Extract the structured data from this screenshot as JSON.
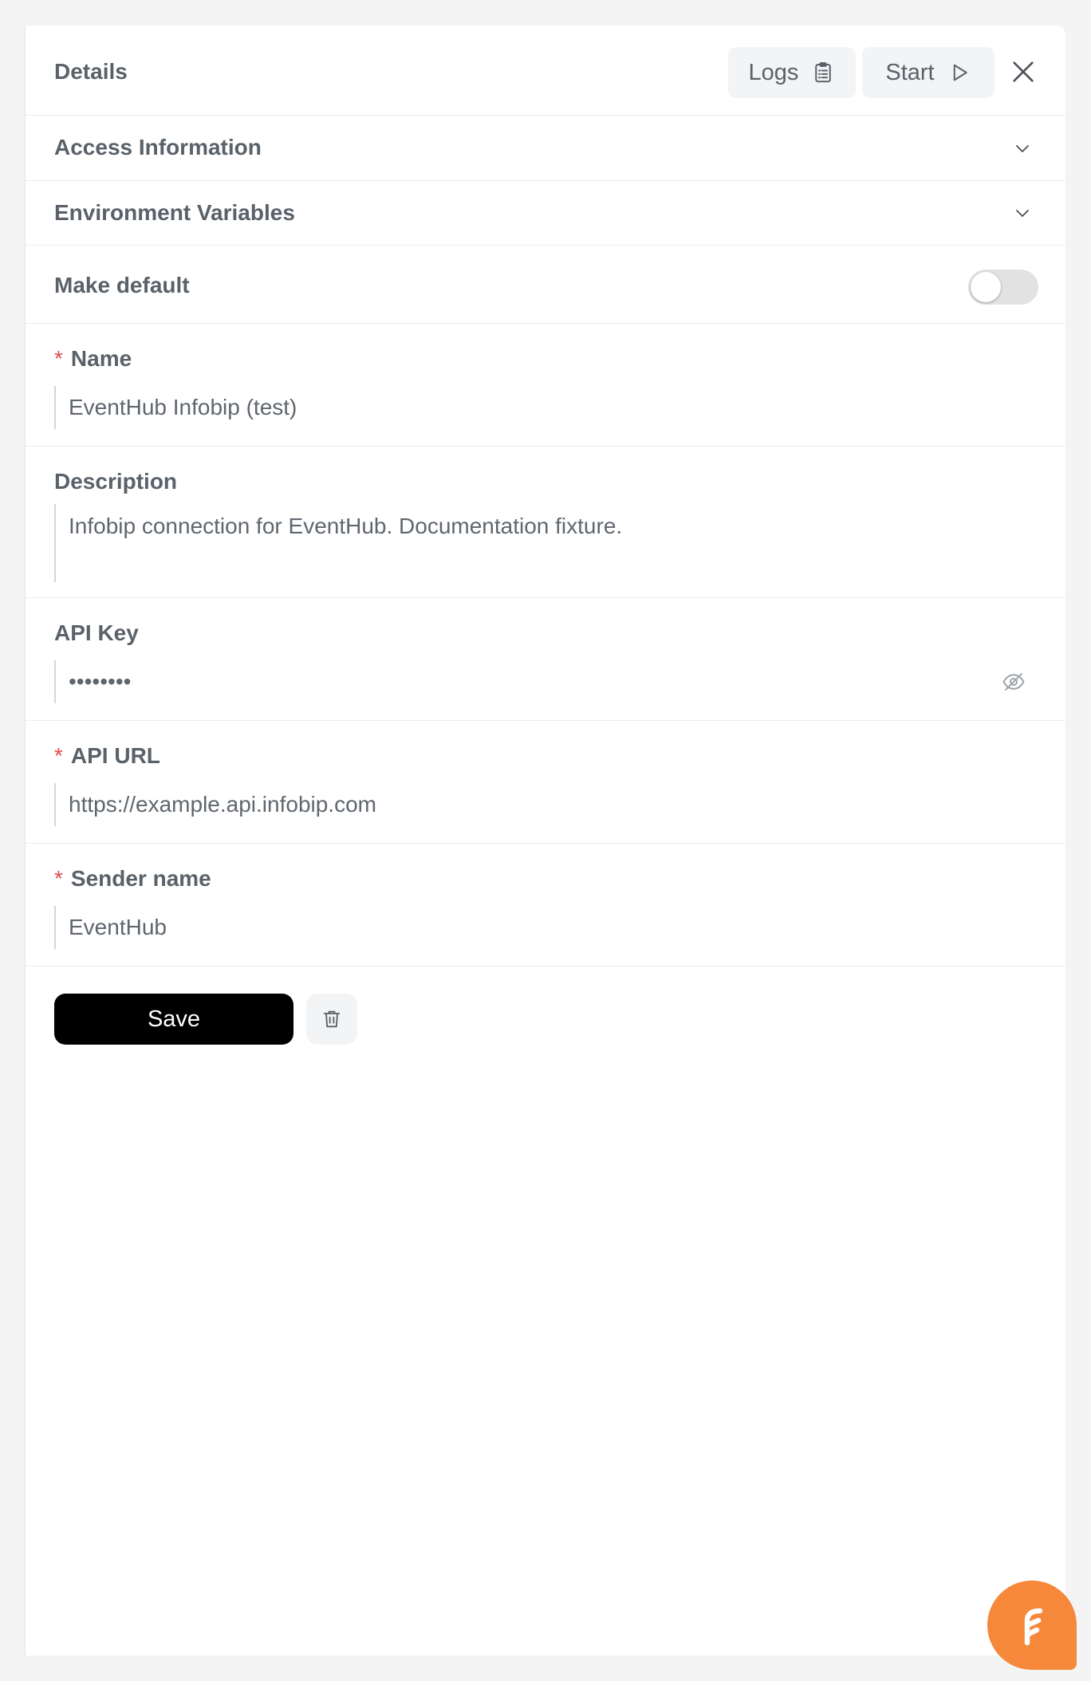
{
  "header": {
    "title": "Details",
    "logs_label": "Logs",
    "start_label": "Start"
  },
  "sections": {
    "access_information": "Access Information",
    "environment_variables": "Environment Variables",
    "make_default": "Make default"
  },
  "toggle": {
    "make_default_on": false
  },
  "form": {
    "name": {
      "required_mark": "*",
      "label": "Name",
      "value": "EventHub Infobip (test)"
    },
    "description": {
      "label": "Description",
      "value": "Infobip connection for EventHub. Documentation fixture."
    },
    "api_key": {
      "label": "API Key",
      "value": "••••••••"
    },
    "api_url": {
      "required_mark": "*",
      "label": "API URL",
      "value": "https://example.api.infobip.com"
    },
    "sender_name": {
      "required_mark": "*",
      "label": "Sender name",
      "value": "EventHub"
    }
  },
  "actions": {
    "save_label": "Save"
  },
  "colors": {
    "chat_bubble": "#f5883b",
    "required": "#e14b4b",
    "primary_button": "#000000"
  },
  "icons": {
    "logs": "clipboard-list-icon",
    "start": "play-icon",
    "close": "close-icon",
    "chevron": "chevron-down-icon",
    "eye": "eye-off-icon",
    "delete": "trash-icon",
    "chat": "chat-logo-icon"
  }
}
